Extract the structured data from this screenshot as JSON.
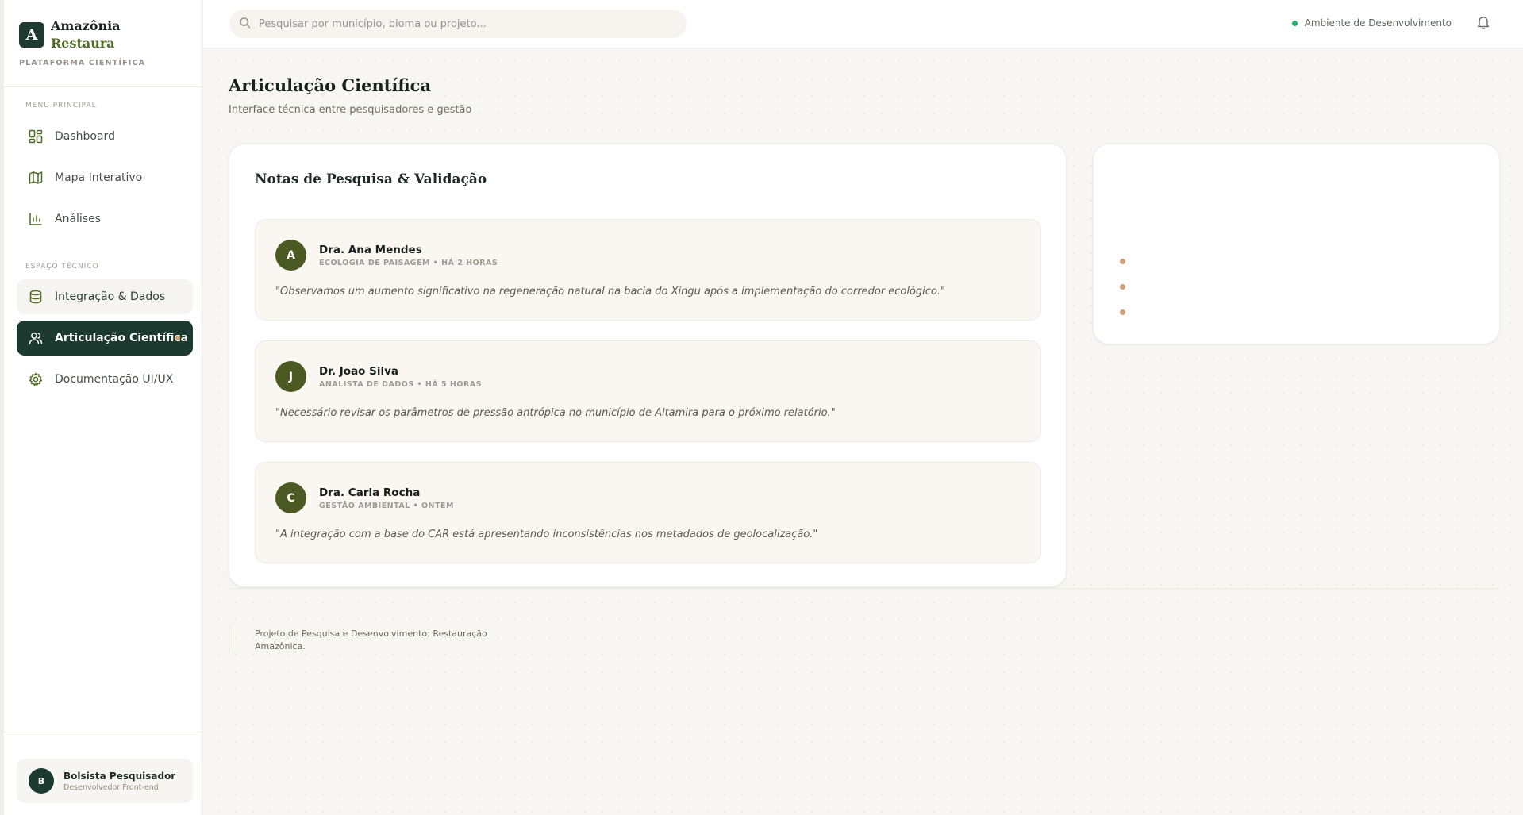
{
  "brand": {
    "logo_letter": "A",
    "name_line1": "Amazônia",
    "name_line2": "Restaura",
    "tagline": "PLATAFORMA CIENTÍFICA"
  },
  "sidebar": {
    "section_main": "MENU PRINCIPAL",
    "section_tech": "ESPAÇO TÉCNICO",
    "items": [
      {
        "label": "Dashboard",
        "icon": "dashboard-icon"
      },
      {
        "label": "Mapa Interativo",
        "icon": "map-icon"
      },
      {
        "label": "Análises",
        "icon": "bar-chart-icon"
      },
      {
        "label": "Integração & Dados",
        "icon": "database-icon"
      },
      {
        "label": "Articulação Científica",
        "icon": "users-icon"
      },
      {
        "label": "Documentação UI/UX",
        "icon": "gear-icon"
      }
    ],
    "user": {
      "initial": "B",
      "name": "Bolsista Pesquisador",
      "role": "Desenvolvedor Front-end"
    }
  },
  "topbar": {
    "search_placeholder": "Pesquisar por município, bioma ou projeto...",
    "environment": "Ambiente de Desenvolvimento"
  },
  "page": {
    "title": "Articulação Científica",
    "subtitle": "Interface técnica entre pesquisadores e gestão"
  },
  "notes": {
    "title": "Notas de Pesquisa & Validação",
    "items": [
      {
        "initial": "A",
        "name": "Dra. Ana Mendes",
        "meta": "ECOLOGIA DE PAISAGEM • HÁ 2 HORAS",
        "text": "\"Observamos um aumento significativo na regeneração natural na bacia do Xingu após a implementação do corredor ecológico.\""
      },
      {
        "initial": "J",
        "name": "Dr. João Silva",
        "meta": "ANALISTA DE DADOS • HÁ 5 HORAS",
        "text": "\"Necessário revisar os parâmetros de pressão antrópica no município de Altamira para o próximo relatório.\""
      },
      {
        "initial": "C",
        "name": "Dra. Carla Rocha",
        "meta": "GESTÃO AMBIENTAL • ONTEM",
        "text": "\"A integração com a base do CAR está apresentando inconsistências nos metadados de geolocalização.\""
      }
    ]
  },
  "footer": {
    "text": "Projeto de Pesquisa e Desenvolvimento: Restauração Amazônica."
  },
  "colors": {
    "primary": "#1c3a2f",
    "olive": "#4a5a22",
    "accent": "#d7a66d",
    "online": "#1fb36c"
  }
}
